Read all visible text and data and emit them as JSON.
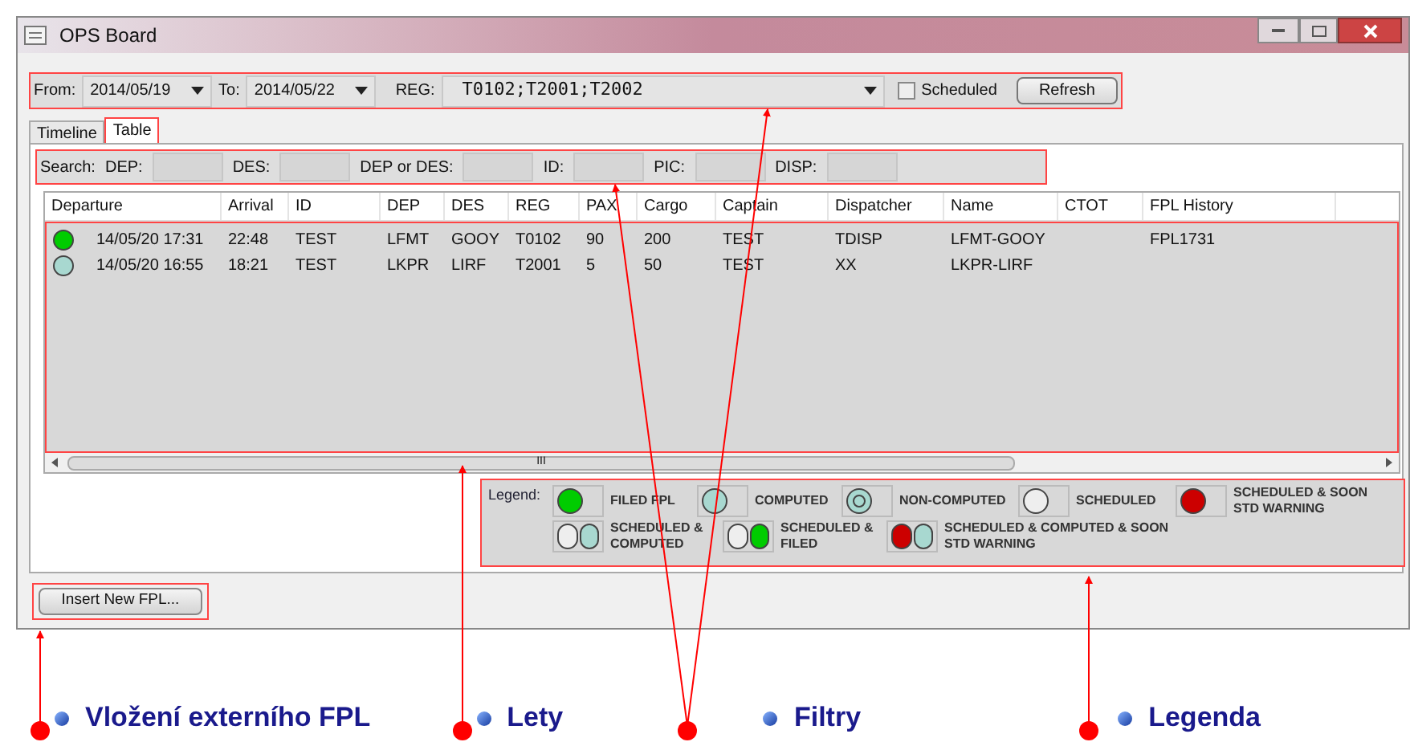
{
  "window": {
    "title": "OPS Board"
  },
  "filters": {
    "from_label": "From:",
    "from": "2014/05/19",
    "to_label": "To:",
    "to": "2014/05/22",
    "reg_label": "REG:",
    "reg": "T0102;T2001;T2002",
    "scheduled": {
      "label": "Scheduled",
      "checked": false
    },
    "refresh": "Refresh"
  },
  "tabs": [
    {
      "label": "Timeline",
      "selected": false
    },
    {
      "label": "Table",
      "selected": true
    }
  ],
  "search": {
    "label": "Search:",
    "fields": [
      {
        "label": "DEP:"
      },
      {
        "label": "DES:"
      },
      {
        "label": "DEP or DES:"
      },
      {
        "label": "ID:"
      },
      {
        "label": "PIC:"
      },
      {
        "label": "DISP:"
      }
    ]
  },
  "table": {
    "columns": [
      "Departure",
      "Arrival",
      "ID",
      "DEP",
      "DES",
      "REG",
      "PAX",
      "Cargo",
      "Captain",
      "Dispatcher",
      "Name",
      "CTOT",
      "FPL History"
    ],
    "rows": [
      {
        "color": "#00cc00",
        "cells": [
          "14/05/20 17:31",
          "22:48",
          "TEST",
          "LFMT",
          "GOOY",
          "T0102",
          "90",
          "200",
          "TEST",
          "TDISP",
          "LFMT-GOOY",
          "",
          "FPL1731"
        ]
      },
      {
        "color": "#a8d8d0",
        "cells": [
          "14/05/20 16:55",
          "18:21",
          "TEST",
          "LKPR",
          "LIRF",
          "T2001",
          "5",
          "50",
          "TEST",
          "XX",
          "LKPR-LIRF",
          "",
          ""
        ]
      }
    ],
    "scrollbar_label": "III"
  },
  "legend": {
    "label": "Legend:",
    "items": [
      {
        "label": "FILED FPL",
        "dots": [
          {
            "kind": "plain",
            "color": "#00cc00"
          }
        ]
      },
      {
        "label": "COMPUTED",
        "dots": [
          {
            "kind": "plain",
            "color": "#a8d8d0"
          }
        ]
      },
      {
        "label": "NON-COMPUTED",
        "dots": [
          {
            "kind": "ring",
            "color": "#a8d8d0"
          }
        ]
      },
      {
        "label": "SCHEDULED",
        "dots": [
          {
            "kind": "plain",
            "color": "#eeeeee"
          }
        ]
      },
      {
        "label": "SCHEDULED & SOON STD WARNING",
        "dots": [
          {
            "kind": "plain",
            "color": "#cc0000"
          }
        ]
      },
      {
        "label": "SCHEDULED & COMPUTED",
        "dots": [
          {
            "kind": "plain",
            "color": "#eeeeee"
          },
          {
            "kind": "plain",
            "color": "#a8d8d0"
          }
        ]
      },
      {
        "label": "SCHEDULED & FILED",
        "dots": [
          {
            "kind": "plain",
            "color": "#eeeeee"
          },
          {
            "kind": "plain",
            "color": "#00cc00"
          }
        ]
      },
      {
        "label": "SCHEDULED & COMPUTED & SOON STD WARNING",
        "dots": [
          {
            "kind": "plain",
            "color": "#cc0000"
          },
          {
            "kind": "plain",
            "color": "#a8d8d0"
          }
        ]
      }
    ]
  },
  "insert_button": "Insert New FPL...",
  "annotations": [
    {
      "label": "Vložení externího FPL"
    },
    {
      "label": "Lety"
    },
    {
      "label": "Filtry"
    },
    {
      "label": "Legenda"
    }
  ]
}
